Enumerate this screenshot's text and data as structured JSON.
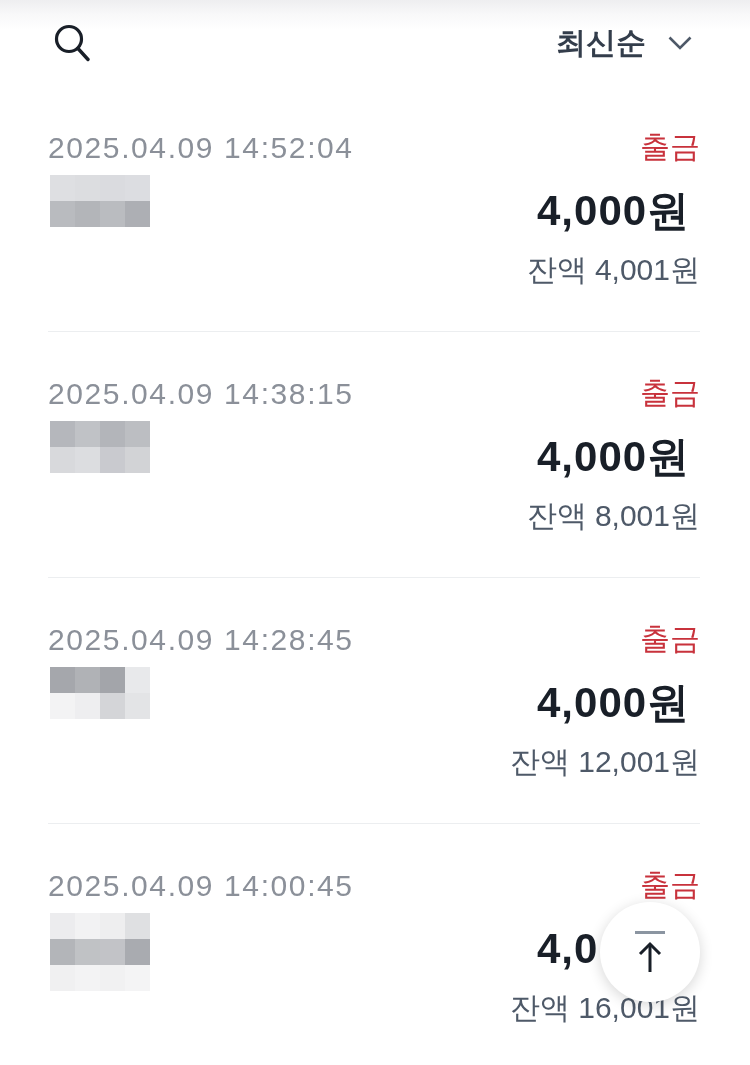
{
  "header": {
    "sort": {
      "label": "최신순"
    }
  },
  "transactions": [
    {
      "time": "2025.04.09 14:52:04",
      "name_redacted": true,
      "type": "출금",
      "amount": "4,000원",
      "balance": "잔액 4,001원"
    },
    {
      "time": "2025.04.09 14:38:15",
      "name_redacted": true,
      "type": "출금",
      "amount": "4,000원",
      "balance": "잔액 8,001원"
    },
    {
      "time": "2025.04.09 14:28:45",
      "name_redacted": true,
      "type": "출금",
      "amount": "4,000원",
      "balance": "잔액 12,001원"
    },
    {
      "time": "2025.04.09 14:00:45",
      "name_redacted": true,
      "type": "출금",
      "amount": "4,0",
      "balance": "잔액 16,001원"
    }
  ]
}
